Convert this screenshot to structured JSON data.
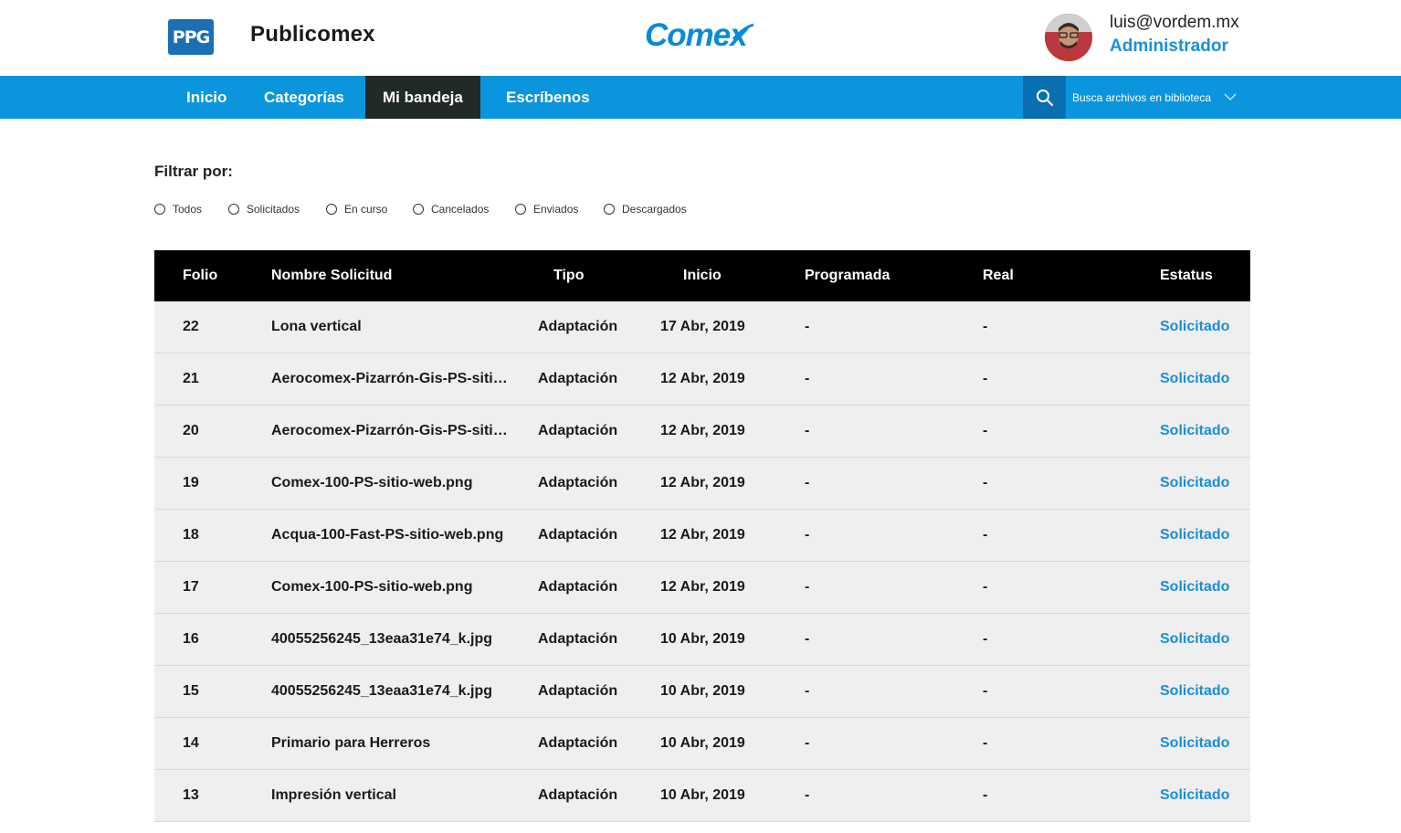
{
  "header": {
    "ppg_logo_text": "PPG",
    "app_name": "Publicomex",
    "brand_logo": "Comex",
    "user_email": "luis@vordem.mx",
    "user_role": "Administrador"
  },
  "nav": {
    "items": [
      {
        "label": "Inicio"
      },
      {
        "label": "Categorías"
      },
      {
        "label": "Mi bandeja"
      },
      {
        "label": "Escríbenos"
      }
    ],
    "active": "Mi bandeja",
    "search_placeholder": "Busca archivos en biblioteca"
  },
  "filter": {
    "title": "Filtrar por:",
    "options": [
      "Todos",
      "Solicitados",
      "En curso",
      "Cancelados",
      "Enviados",
      "Descargados"
    ]
  },
  "table": {
    "headers": {
      "folio": "Folio",
      "name": "Nombre Solicitud",
      "tipo": "Tipo",
      "inicio": "Inicio",
      "programada": "Programada",
      "real": "Real",
      "estatus": "Estatus"
    },
    "rows": [
      {
        "folio": "22",
        "name": "Lona vertical",
        "tipo": "Adaptación",
        "inicio": "17 Abr, 2019",
        "programada": "-",
        "real": "-",
        "estatus": "Solicitado"
      },
      {
        "folio": "21",
        "name": "Aerocomex-Pizarrón-Gis-PS-sitio…",
        "tipo": "Adaptación",
        "inicio": "12 Abr, 2019",
        "programada": "-",
        "real": "-",
        "estatus": "Solicitado"
      },
      {
        "folio": "20",
        "name": "Aerocomex-Pizarrón-Gis-PS-sitio…",
        "tipo": "Adaptación",
        "inicio": "12 Abr, 2019",
        "programada": "-",
        "real": "-",
        "estatus": "Solicitado"
      },
      {
        "folio": "19",
        "name": "Comex-100-PS-sitio-web.png",
        "tipo": "Adaptación",
        "inicio": "12 Abr, 2019",
        "programada": "-",
        "real": "-",
        "estatus": "Solicitado"
      },
      {
        "folio": "18",
        "name": "Acqua-100-Fast-PS-sitio-web.png",
        "tipo": "Adaptación",
        "inicio": "12 Abr, 2019",
        "programada": "-",
        "real": "-",
        "estatus": "Solicitado"
      },
      {
        "folio": "17",
        "name": "Comex-100-PS-sitio-web.png",
        "tipo": "Adaptación",
        "inicio": "12 Abr, 2019",
        "programada": "-",
        "real": "-",
        "estatus": "Solicitado"
      },
      {
        "folio": "16",
        "name": "40055256245_13eaa31e74_k.jpg",
        "tipo": "Adaptación",
        "inicio": "10 Abr, 2019",
        "programada": "-",
        "real": "-",
        "estatus": "Solicitado"
      },
      {
        "folio": "15",
        "name": "40055256245_13eaa31e74_k.jpg",
        "tipo": "Adaptación",
        "inicio": "10 Abr, 2019",
        "programada": "-",
        "real": "-",
        "estatus": "Solicitado"
      },
      {
        "folio": "14",
        "name": "Primario para Herreros",
        "tipo": "Adaptación",
        "inicio": "10 Abr, 2019",
        "programada": "-",
        "real": "-",
        "estatus": "Solicitado"
      },
      {
        "folio": "13",
        "name": "Impresión vertical",
        "tipo": "Adaptación",
        "inicio": "10 Abr, 2019",
        "programada": "-",
        "real": "-",
        "estatus": "Solicitado"
      }
    ]
  },
  "icons": {
    "search": "search-icon",
    "chevron": "chevron-down-icon",
    "avatar": "user-avatar"
  },
  "colors": {
    "nav_bg": "#0b95dd",
    "nav_active_bg": "#222a26",
    "search_btn_bg": "#0a6fb0",
    "accent_blue": "#1a8fd8",
    "table_header_bg": "#000000",
    "row_bg": "#efefef",
    "ppg_blue": "#1a6fb5"
  }
}
